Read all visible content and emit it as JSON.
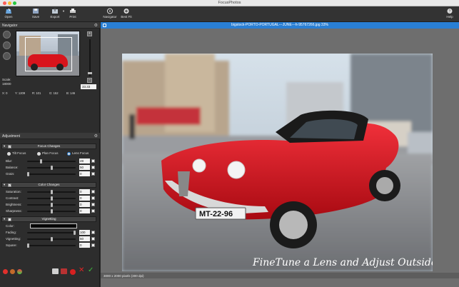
{
  "window": {
    "title": "FocusPhotos"
  },
  "toolbar": {
    "open": "Open",
    "save": "Save",
    "export": "Export",
    "print": "Print",
    "navigator": "Navigator",
    "best_fit": "Best Fit",
    "help": "Help"
  },
  "navigator": {
    "title": "Navigator",
    "scale_label": "Scale:",
    "scale_value": "18000",
    "zoom_value": "33.33",
    "readout": {
      "x": "X: 0",
      "y": "Y: 1209",
      "r": "R: 101",
      "g": "G: 152",
      "b": "B: 146"
    }
  },
  "adjustment": {
    "title": "Adjustment",
    "focus": {
      "header": "Focus Changes",
      "modes": [
        "Tilt Focus",
        "Plan Focus",
        "Lens Focus"
      ],
      "selected_mode": 2,
      "rows": [
        {
          "label": "Blur:",
          "value": "28",
          "level": 0.28
        },
        {
          "label": "Balance:",
          "value": "50",
          "level": 0.5
        },
        {
          "label": "Grain:",
          "value": "0",
          "level": 0.0
        }
      ]
    },
    "color": {
      "header": "Color Changes",
      "rows": [
        {
          "label": "Saturation:",
          "value": "0",
          "level": 0.5
        },
        {
          "label": "Contrast:",
          "value": "0",
          "level": 0.5
        },
        {
          "label": "Brightness:",
          "value": "0",
          "level": 0.5
        },
        {
          "label": "Sharpness:",
          "value": "0",
          "level": 0.5
        }
      ]
    },
    "vignetting": {
      "header": "Vignetting",
      "color_label": "Color:",
      "rows": [
        {
          "label": "Fading:",
          "value": "100",
          "level": 1.0
        },
        {
          "label": "Vignetting:",
          "value": "50",
          "level": 0.5
        },
        {
          "label": "Square:",
          "value": "0",
          "level": 0.0
        }
      ]
    }
  },
  "document": {
    "title": "bigstock-PORTO-PORTUGAL---JUNE---h-95767266.jpg 33%",
    "caption": "FineTune a Lens and Adjust Outside Blur",
    "status": "3000 x 2000 pixels (300 dpi)",
    "plate": "MT-22-96"
  },
  "colors": {
    "accent": "#2a7fd4",
    "car": "#d8141c"
  }
}
